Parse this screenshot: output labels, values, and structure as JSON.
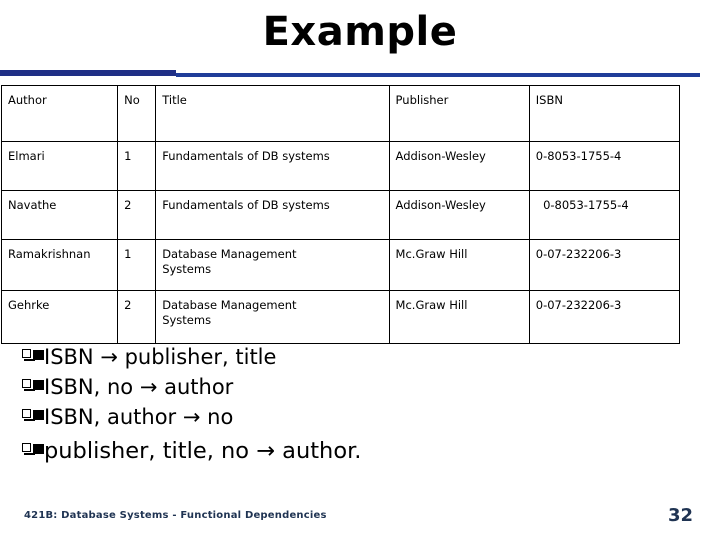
{
  "slide": {
    "title": "Example",
    "page_number": "32",
    "footer": "421B: Database Systems - Functional Dependencies",
    "accent_color": "#1f2f86",
    "footer_color": "#1f3352"
  },
  "table": {
    "headers": {
      "author": "Author",
      "no": "No",
      "title": "Title",
      "publisher": "Publisher",
      "isbn": "ISBN"
    },
    "rows": [
      {
        "author": "Elmari",
        "no": "1",
        "title": "Fundamentals of DB systems",
        "publisher": "Addison-Wesley",
        "isbn": "0-8053-1755-4"
      },
      {
        "author": "Navathe",
        "no": "2",
        "title": "Fundamentals of DB systems",
        "publisher": "Addison-Wesley",
        "isbn": "  0-8053-1755-4"
      },
      {
        "author": "Ramakrishnan",
        "no": "1",
        "title": "Database Management\nSystems",
        "publisher": "Mc.Graw Hill",
        "isbn": "0-07-232206-3"
      },
      {
        "author": "Gehrke",
        "no": "2",
        "title": "Database Management\nSystems",
        "publisher": "Mc.Graw Hill",
        "isbn": "0-07-232206-3"
      }
    ]
  },
  "dependencies": {
    "items": [
      "ISBN → publisher, title",
      "ISBN, no → author",
      "ISBN, author → no",
      "publisher, title, no → author."
    ]
  }
}
